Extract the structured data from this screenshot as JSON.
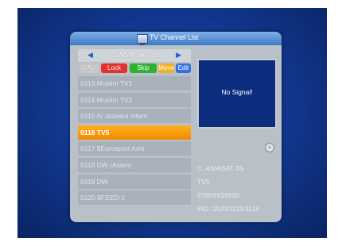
{
  "window": {
    "title": "TV Channel List"
  },
  "satellite": {
    "name": "C. ASIASAT 3S",
    "prev_icon": "left-arrow",
    "next_icon": "right-arrow"
  },
  "buttons": {
    "fav": "FAV",
    "lock": "Lock",
    "skip": "Skip",
    "move": "Move",
    "edit": "Edit"
  },
  "channels": [
    "0113 Muslim TV1",
    "0114 Muslim TV2",
    "0115 Al Jazeera Intern",
    "0116 TV5",
    "0117 $Eurosport Asia",
    "0118 DW (Asien)",
    "0119 DW",
    "0120 $FEED-1"
  ],
  "selected_index": 3,
  "preview": {
    "status": "No Signal!"
  },
  "info": {
    "icon": "info-icon",
    "satellite": "C. ASIASAT 3S",
    "channel": "TV5",
    "transponder": "3760/H/26000",
    "pid": "PID: 1120/1121/1120"
  },
  "colors": {
    "selected": "#f39a10",
    "lock": "#e33030",
    "skip": "#2eb030",
    "move": "#f0b020",
    "edit": "#3070e0"
  }
}
